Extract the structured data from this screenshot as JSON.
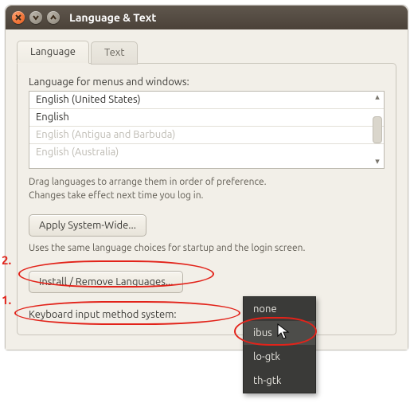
{
  "window": {
    "title": "Language & Text"
  },
  "tabs": {
    "language": "Language",
    "text": "Text"
  },
  "lang_section": {
    "heading": "Language for menus and windows:",
    "items": [
      "English (United States)",
      "English",
      "English (Antigua and Barbuda)",
      "English (Australia)"
    ],
    "drag_hint_1": "Drag languages to arrange them in order of preference.",
    "drag_hint_2": "Changes take effect next time you log in.",
    "apply_btn": "Apply System-Wide...",
    "apply_hint": "Uses the same language choices for startup and the login screen.",
    "install_btn": "Install / Remove Languages..."
  },
  "keyboard": {
    "label": "Keyboard input method system:",
    "options": [
      "none",
      "ibus",
      "lo-gtk",
      "th-gtk"
    ],
    "hover_index": 1
  },
  "annotations": {
    "one": "1.",
    "two": "2."
  }
}
